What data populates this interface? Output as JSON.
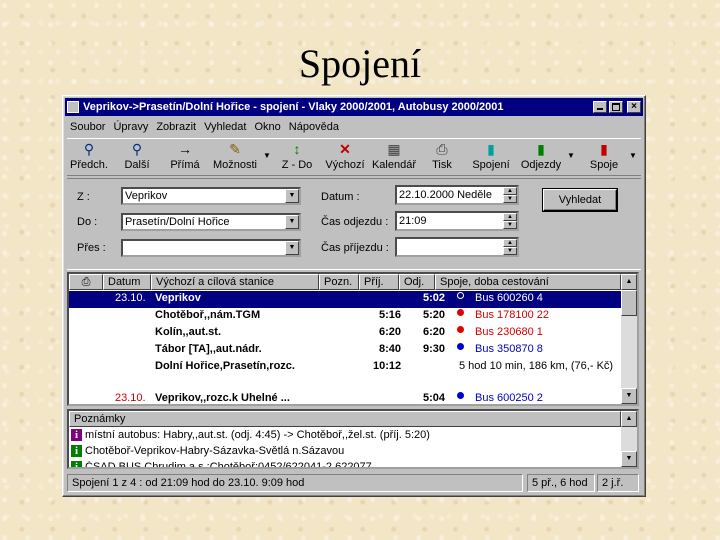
{
  "slide": {
    "title": "Spojení"
  },
  "window": {
    "title": "Veprikov->Prasetín/Dolní Hořice - spojení - Vlaky 2000/2001, Autobusy 2000/2001",
    "close_glyph": "×"
  },
  "menu": [
    {
      "label": "Soubor"
    },
    {
      "label": "Úpravy"
    },
    {
      "label": "Zobrazit"
    },
    {
      "label": "Vyhledat"
    },
    {
      "label": "Okno"
    },
    {
      "label": "Nápověda"
    }
  ],
  "toolbar": [
    {
      "label": "Předch.",
      "icon": "binoculars-back-icon",
      "glyph": "⚲"
    },
    {
      "label": "Další",
      "icon": "binoculars-next-icon",
      "glyph": "⚲"
    },
    {
      "label": "Přímá",
      "icon": "arrow-right-icon",
      "glyph": "→"
    },
    {
      "label": "Možnosti",
      "icon": "options-icon",
      "glyph": "✎"
    },
    {
      "label": "Z - Do",
      "icon": "swap-icon",
      "glyph": "↕"
    },
    {
      "label": "Výchozí",
      "icon": "reset-x-icon",
      "glyph": "✕"
    },
    {
      "label": "Kalendář",
      "icon": "calendar-icon",
      "glyph": "▦"
    },
    {
      "label": "Tisk",
      "icon": "printer-icon",
      "glyph": "⎙"
    },
    {
      "label": "Spojení",
      "icon": "book-cyan-icon",
      "glyph": "▮"
    },
    {
      "label": "Odjezdy",
      "icon": "book-green-icon",
      "glyph": "▮"
    },
    {
      "label": "Spoje",
      "icon": "book-red-icon",
      "glyph": "▮"
    }
  ],
  "form": {
    "from_label": "Z :",
    "from_value": "Veprikov",
    "to_label": "Do :",
    "to_value": "Prasetín/Dolní Hořice",
    "via_label": "Přes :",
    "via_value": "",
    "date_label": "Datum :",
    "date_value": "22.10.2000 Neděle",
    "dep_label": "Čas odjezdu :",
    "dep_value": "21:09",
    "arr_label": "Čas příjezdu :",
    "arr_value": "",
    "search_button": "Vyhledat"
  },
  "grid": {
    "headers": [
      "Datum",
      "Výchozí a cílová stanice",
      "Pozn.",
      "Příj.",
      "Odj.",
      "Spoje, doba cestování"
    ],
    "rows": [
      {
        "date": "23.10.",
        "station": "Veprikov",
        "arr": "",
        "dep": "5:02",
        "dot": "hollow",
        "conn": "Bus 600260 4",
        "conn_color": "blue",
        "selected": true
      },
      {
        "date": "",
        "station": "Chotěboř,,nám.TGM",
        "arr": "5:16",
        "dep": "5:20",
        "dot": "red",
        "conn": "Bus 178100 22",
        "conn_color": "red"
      },
      {
        "date": "",
        "station": "Kolín,,aut.st.",
        "arr": "6:20",
        "dep": "6:20",
        "dot": "red",
        "conn": "Bus 230680 1",
        "conn_color": "red"
      },
      {
        "date": "",
        "station": "Tábor [TA],,aut.nádr.",
        "arr": "8:40",
        "dep": "9:30",
        "dot": "blue",
        "conn": "Bus 350870 8",
        "conn_color": "blue"
      },
      {
        "date": "",
        "station": "Dolní Hořice,Prasetín,rozc.",
        "arr": "10:12",
        "dep": "",
        "dot": "none",
        "conn": "5 hod 10 min, 186 km, (76,- Kč)",
        "conn_color": "black"
      },
      {
        "date": "23.10.",
        "station": "Veprikov,,rozc.k Uhelné ...",
        "arr": "",
        "dep": "5:04",
        "dot": "blue",
        "conn": "Bus 600250 2",
        "conn_color": "blue"
      }
    ]
  },
  "notes": {
    "header": "Poznámky",
    "items": [
      {
        "text": "místní autobus: Habry,,aut.st. (odj. 4:45) -> Chotěboř,,žel.st. (příj. 5:20)",
        "color": "#800080"
      },
      {
        "text": "Chotěboř-Veprikov-Habry-Sázavka-Světlá n.Sázavou",
        "color": "#008000"
      },
      {
        "text": "ČSAD BUS Chrudim a.s.;Chotěboř;0452/622041-2,622077",
        "color": "#008000"
      }
    ]
  },
  "status": {
    "main": "Spojení 1 z 4 : od 21:09 hod do 23.10. 9:09 hod",
    "transfers": "5 př., 6 hod",
    "days": "2 j.ř."
  }
}
